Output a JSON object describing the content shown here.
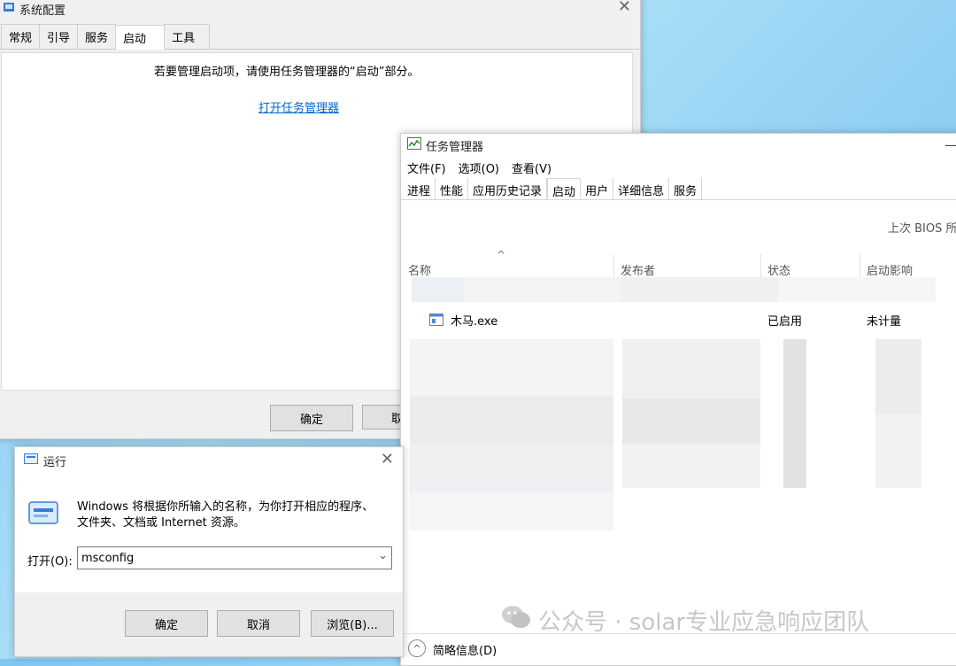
{
  "msconfig": {
    "title": "系统配置",
    "tabs": [
      "常规",
      "引导",
      "服务",
      "启动",
      "工具"
    ],
    "message": "若要管理启动项，请使用任务管理器的“启动”部分。",
    "link": "打开任务管理器",
    "ok": "确定",
    "cancel_partial": "取"
  },
  "taskmgr": {
    "title": "任务管理器",
    "menu": [
      "文件(F)",
      "选项(O)",
      "查看(V)"
    ],
    "tabs": [
      "进程",
      "性能",
      "应用历史记录",
      "启动",
      "用户",
      "详细信息",
      "服务"
    ],
    "bios": "上次 BIOS 所",
    "columns": [
      "名称",
      "发布者",
      "状态",
      "启动影响"
    ],
    "row": {
      "name": "木马.exe",
      "status": "已启用",
      "impact": "未计量"
    },
    "fewer_details": "简略信息(D)"
  },
  "run": {
    "title": "运行",
    "desc1": "Windows 将根据你所输入的名称，为你打开相应的程序、",
    "desc2": "文件夹、文档或 Internet 资源。",
    "open_label": "打开(O):",
    "value": "msconfig",
    "ok": "确定",
    "cancel": "取消",
    "browse": "浏览(B)..."
  },
  "watermark": "公众号 · solar专业应急响应团队",
  "colors": {
    "link": "#0066cc",
    "accent": "#0078d7"
  }
}
